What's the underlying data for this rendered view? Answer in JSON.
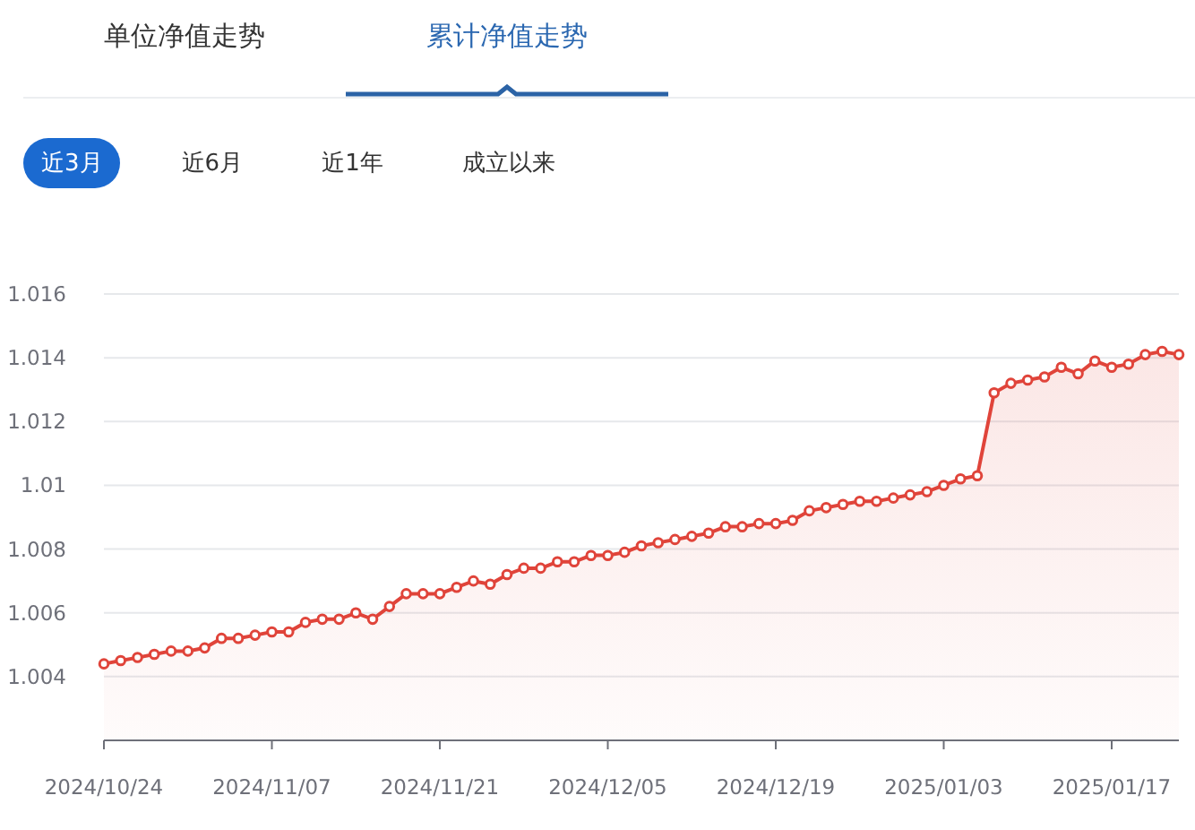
{
  "tabs": [
    {
      "label": "单位净值走势",
      "selected": false
    },
    {
      "label": "累计净值走势",
      "selected": true
    }
  ],
  "periods": [
    {
      "label": "近3月",
      "selected": true
    },
    {
      "label": "近6月",
      "selected": false
    },
    {
      "label": "近1年",
      "selected": false
    },
    {
      "label": "成立以来",
      "selected": false
    }
  ],
  "chart": {
    "chart_data": {
      "type": "area",
      "grid": true,
      "ylim": [
        1.002,
        1.016
      ],
      "yticks": [
        1.004,
        1.006,
        1.008,
        1.01,
        1.012,
        1.014,
        1.016
      ],
      "categories": [
        "2024/10/24",
        null,
        null,
        null,
        null,
        null,
        null,
        null,
        null,
        null,
        "2024/11/07",
        null,
        null,
        null,
        null,
        null,
        null,
        null,
        null,
        null,
        "2024/11/21",
        null,
        null,
        null,
        null,
        null,
        null,
        null,
        null,
        null,
        "2024/12/05",
        null,
        null,
        null,
        null,
        null,
        null,
        null,
        null,
        null,
        "2024/12/19",
        null,
        null,
        null,
        null,
        null,
        null,
        null,
        null,
        null,
        "2025/01/03",
        null,
        null,
        null,
        null,
        null,
        null,
        null,
        null,
        null,
        "2025/01/17",
        null,
        null,
        null,
        null
      ],
      "series": [
        {
          "color": "#e0443a",
          "values": [
            1.0044,
            1.0045,
            1.0046,
            1.0047,
            1.0048,
            1.0048,
            1.0049,
            1.0052,
            1.0052,
            1.0053,
            1.0054,
            1.0054,
            1.0057,
            1.0058,
            1.0058,
            1.006,
            1.0058,
            1.0062,
            1.0066,
            1.0066,
            1.0066,
            1.0068,
            1.007,
            1.0069,
            1.0072,
            1.0074,
            1.0074,
            1.0076,
            1.0076,
            1.0078,
            1.0078,
            1.0079,
            1.0081,
            1.0082,
            1.0083,
            1.0084,
            1.0085,
            1.0087,
            1.0087,
            1.0088,
            1.0088,
            1.0089,
            1.0092,
            1.0093,
            1.0094,
            1.0095,
            1.0095,
            1.0096,
            1.0097,
            1.0098,
            1.01,
            1.0102,
            1.0103,
            1.0129,
            1.0132,
            1.0133,
            1.0134,
            1.0137,
            1.0135,
            1.0139,
            1.0137,
            1.0138,
            1.0141,
            1.0142,
            1.0141
          ]
        }
      ]
    }
  }
}
